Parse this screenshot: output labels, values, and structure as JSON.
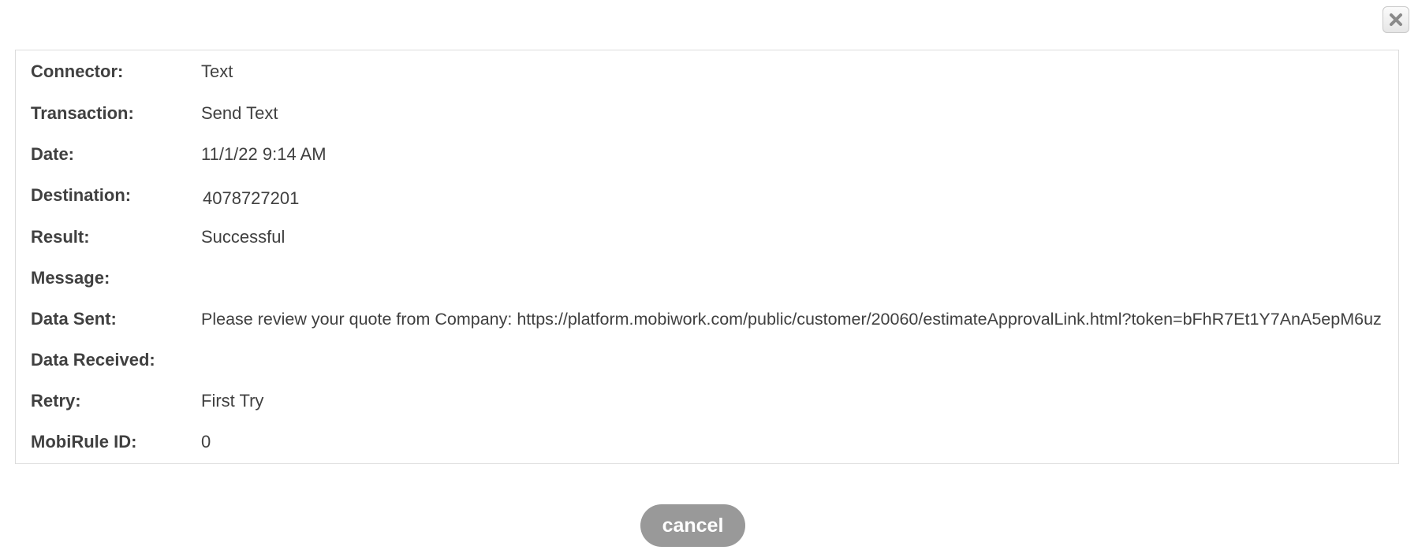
{
  "dialog": {
    "close_icon": "close-x-icon",
    "details": [
      {
        "label": "Connector:",
        "value": "Text"
      },
      {
        "label": "Transaction:",
        "value": "Send Text"
      },
      {
        "label": "Date:",
        "value": "11/1/22 9:14 AM"
      },
      {
        "label": "Destination:",
        "value": "4078727201"
      },
      {
        "label": "Result:",
        "value": "Successful"
      },
      {
        "label": "Message:",
        "value": ""
      },
      {
        "label": "Data Sent:",
        "value": "Please review your quote from Company: https://platform.mobiwork.com/public/customer/20060/estimateApprovalLink.html?token=bFhR7Et1Y7AnA5epM6uz"
      },
      {
        "label": "Data Received:",
        "value": ""
      },
      {
        "label": "Retry:",
        "value": "First Try"
      },
      {
        "label": "MobiRule ID:",
        "value": "0"
      }
    ],
    "cancel_label": "cancel"
  }
}
